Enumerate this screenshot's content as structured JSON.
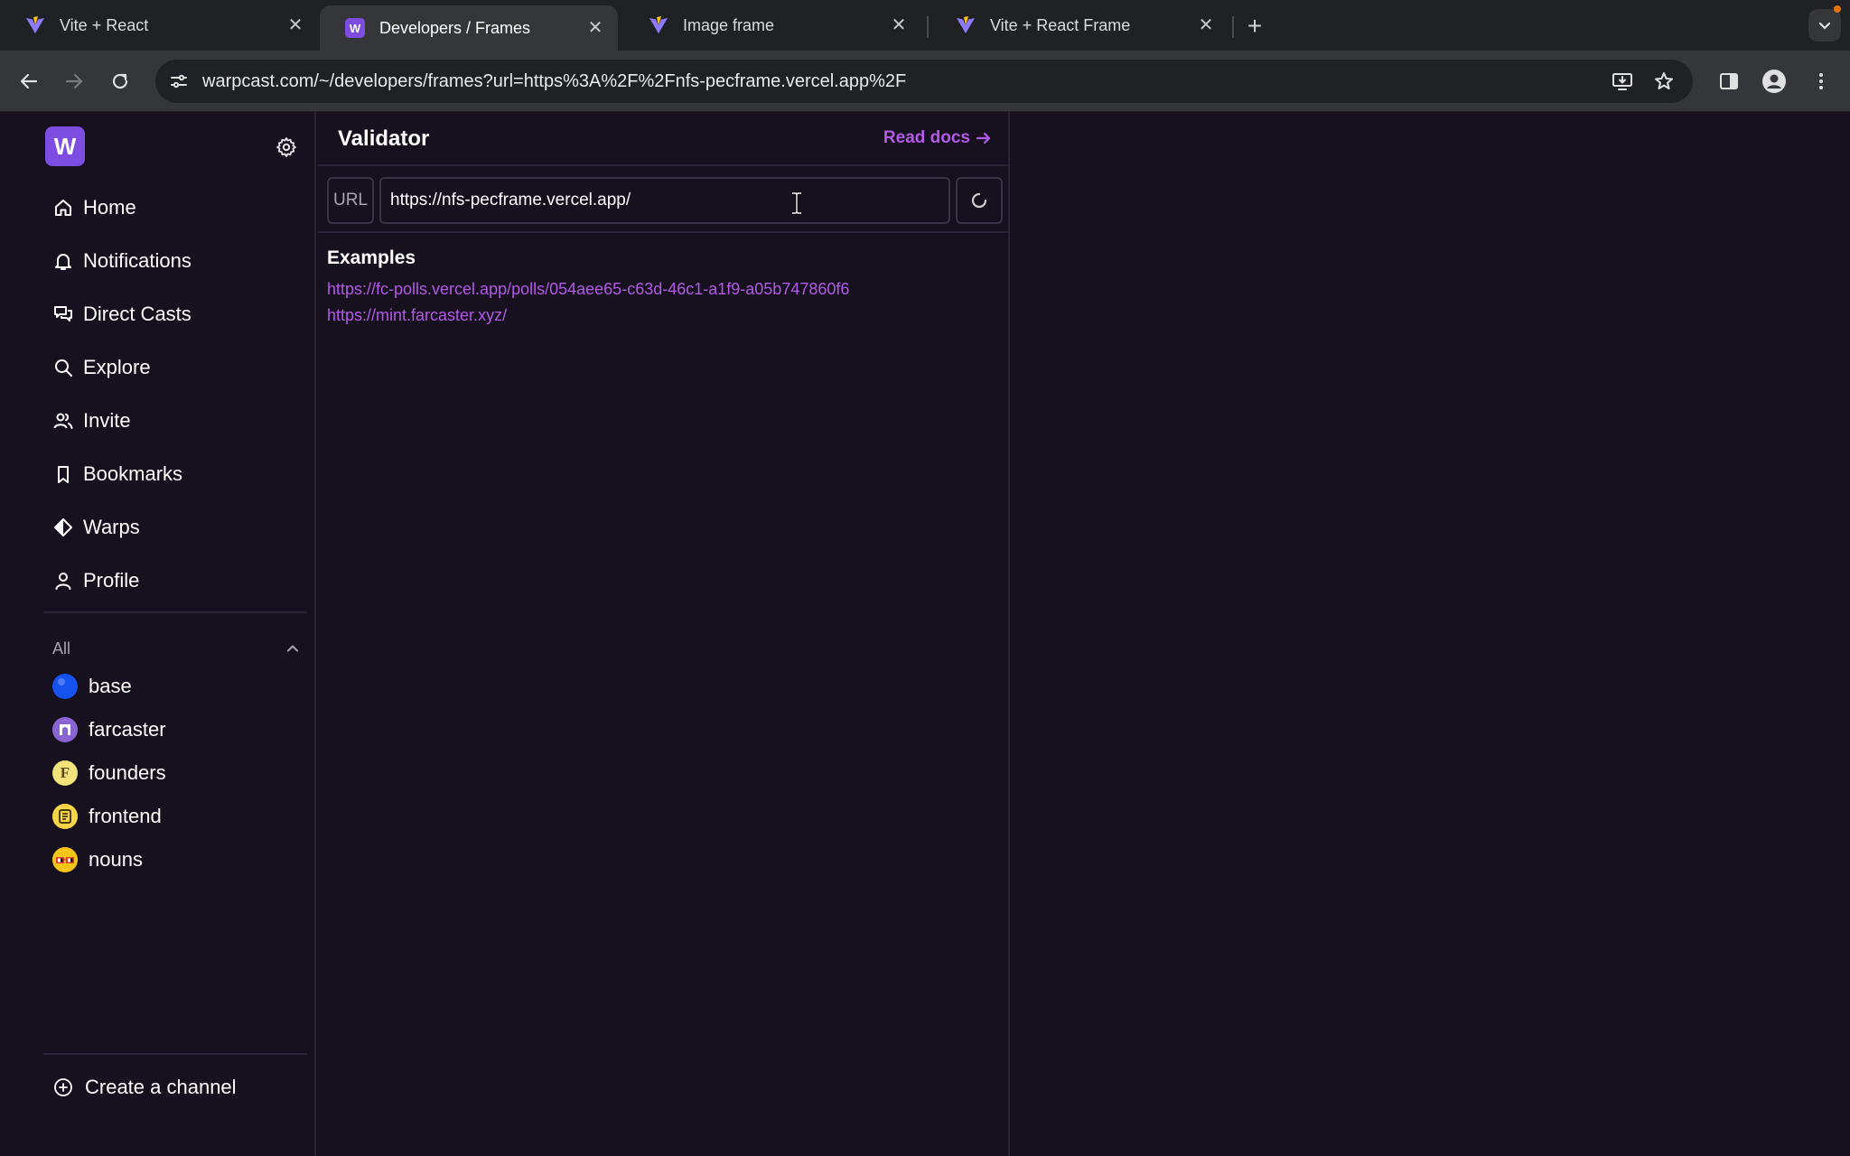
{
  "browser": {
    "tabs": [
      {
        "title": "Vite + React",
        "favicon": "vite-icon",
        "active": false
      },
      {
        "title": "Developers / Frames",
        "favicon": "warpcast-icon",
        "active": true
      },
      {
        "title": "Image frame",
        "favicon": "vite-icon",
        "active": false
      },
      {
        "title": "Vite + React Frame",
        "favicon": "vite-icon",
        "active": false
      }
    ],
    "url": "warpcast.com/~/developers/frames?url=https%3A%2F%2Fnfs-pecframe.vercel.app%2F"
  },
  "sidebar": {
    "logo_letter": "W",
    "nav": [
      {
        "label": "Home",
        "icon": "home-icon"
      },
      {
        "label": "Notifications",
        "icon": "bell-icon"
      },
      {
        "label": "Direct Casts",
        "icon": "chat-icon"
      },
      {
        "label": "Explore",
        "icon": "search-icon"
      },
      {
        "label": "Invite",
        "icon": "users-icon"
      },
      {
        "label": "Bookmarks",
        "icon": "bookmark-icon"
      },
      {
        "label": "Warps",
        "icon": "diamond-icon"
      },
      {
        "label": "Profile",
        "icon": "user-icon"
      }
    ],
    "section_label": "All",
    "channels": [
      {
        "label": "base",
        "color": "#1652f0"
      },
      {
        "label": "farcaster",
        "color": "#8a63d2"
      },
      {
        "label": "founders",
        "color": "#f2e27a",
        "glyph": "F"
      },
      {
        "label": "frontend",
        "color": "#f5d547"
      },
      {
        "label": "nouns",
        "color": "#f5c518"
      }
    ],
    "create_label": "Create a channel"
  },
  "main": {
    "title": "Validator",
    "read_docs": "Read docs",
    "url_tag": "URL",
    "url_value": "https://nfs-pecframe.vercel.app/",
    "examples_title": "Examples",
    "examples": [
      "https://fc-polls.vercel.app/polls/054aee65-c63d-46c1-a1f9-a05b747860f6",
      "https://mint.farcaster.xyz/"
    ]
  },
  "colors": {
    "accent": "#b35ae8",
    "background": "#17101f",
    "brand": "#7c4de0"
  }
}
